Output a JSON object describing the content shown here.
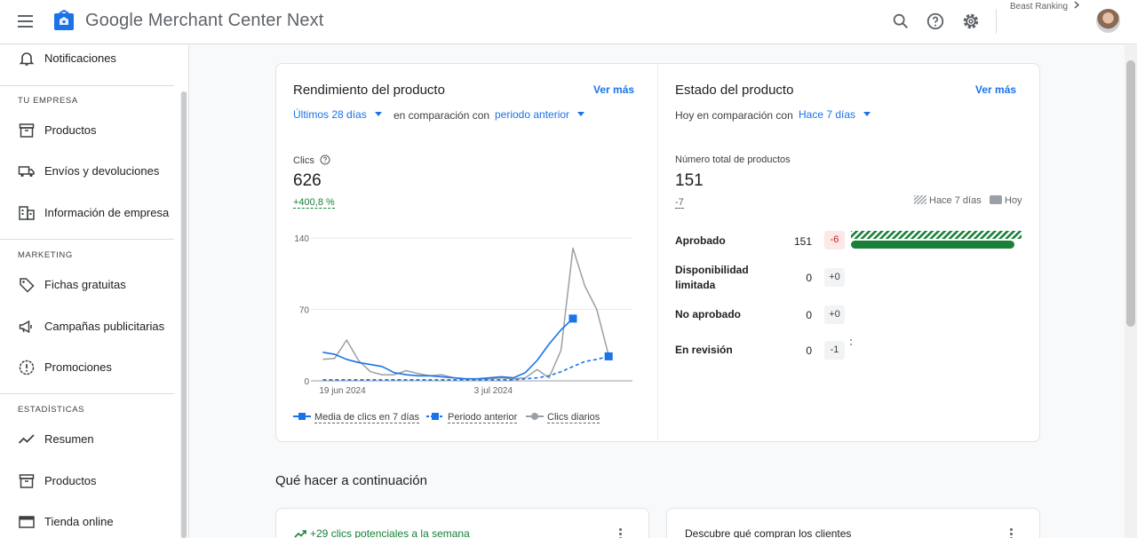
{
  "header": {
    "app_title": "Google Merchant Center Next",
    "account_name": "Beast Ranking"
  },
  "icons": [
    "menu-icon",
    "merchant-logo-icon",
    "search-icon",
    "help-icon",
    "settings-icon",
    "chevron-right-icon"
  ],
  "sidebar": {
    "notifications": "Notificaciones",
    "sections": [
      {
        "title": "TU EMPRESA",
        "items": [
          "Productos",
          "Envíos y devoluciones",
          "Información de empresa"
        ]
      },
      {
        "title": "MARKETING",
        "items": [
          "Fichas gratuitas",
          "Campañas publicitarias",
          "Promociones"
        ]
      },
      {
        "title": "ESTADÍSTICAS",
        "items": [
          "Resumen",
          "Productos",
          "Tienda online"
        ]
      }
    ]
  },
  "performance": {
    "title": "Rendimiento del producto",
    "see_more": "Ver más",
    "range": "Últimos 28 días",
    "compare_text": "en comparación con",
    "compare_period": "periodo anterior",
    "metric_label": "Clics",
    "metric_value": "626",
    "metric_delta": "+400,8 %"
  },
  "status": {
    "title": "Estado del producto",
    "see_more": "Ver más",
    "compare_text": "Hoy en comparación con",
    "compare_period": "Hace 7 días",
    "total_label": "Número total de productos",
    "total_value": "151",
    "total_delta": "-7",
    "legend_past": "Hace 7 días",
    "legend_today": "Hoy",
    "rows": [
      {
        "label": "Aprobado",
        "value": "151",
        "delta": "-6",
        "bar_fraction": 1.0
      },
      {
        "label": "Disponibilidad limitada",
        "value": "0",
        "delta": "+0",
        "bar_fraction": 0
      },
      {
        "label": "No aprobado",
        "value": "0",
        "delta": "+0",
        "bar_fraction": 0
      },
      {
        "label": "En revisión",
        "value": "0",
        "delta": "-1",
        "bar_fraction": 0
      }
    ],
    "colors": {
      "approved": "#188038",
      "negative": "#c5221f"
    }
  },
  "chart_data": {
    "type": "line",
    "ylim": [
      0,
      140
    ],
    "y_ticks": [
      "0",
      "70",
      "140"
    ],
    "x_tick_labels": [
      "19 jun 2024",
      "3 jul 2024"
    ],
    "x": [
      1,
      2,
      3,
      4,
      5,
      6,
      7,
      8,
      9,
      10,
      11,
      12,
      13,
      14,
      15,
      16,
      17,
      18,
      19,
      20,
      21,
      22,
      23,
      24,
      25,
      26,
      27,
      28
    ],
    "series": [
      {
        "name": "Media de clics en 7 días",
        "color": "#1a73e8",
        "style": "solid",
        "marker": "square",
        "values": [
          null,
          null,
          null,
          null,
          null,
          null,
          null,
          null,
          null,
          null,
          null,
          null,
          null,
          null,
          null,
          null,
          null,
          null,
          null,
          null,
          null,
          null,
          null,
          null,
          null,
          null,
          null,
          null
        ],
        "points": [
          [
            2,
            28
          ],
          [
            3,
            26
          ],
          [
            4,
            21
          ],
          [
            5,
            18
          ],
          [
            6,
            16
          ],
          [
            7,
            14
          ],
          [
            8,
            8
          ],
          [
            9,
            6
          ],
          [
            10,
            5
          ],
          [
            11,
            5
          ],
          [
            12,
            4
          ],
          [
            13,
            3
          ],
          [
            14,
            2
          ],
          [
            15,
            2
          ],
          [
            16,
            3
          ],
          [
            17,
            4
          ],
          [
            18,
            3
          ],
          [
            19,
            8
          ],
          [
            20,
            20
          ],
          [
            21,
            36
          ],
          [
            22,
            50
          ],
          [
            23,
            61
          ]
        ]
      },
      {
        "name": "Periodo anterior",
        "color": "#1a73e8",
        "style": "dashed",
        "marker": "square",
        "points": [
          [
            2,
            1
          ],
          [
            3,
            1
          ],
          [
            4,
            1
          ],
          [
            5,
            1
          ],
          [
            6,
            1
          ],
          [
            7,
            1
          ],
          [
            8,
            1
          ],
          [
            9,
            1
          ],
          [
            10,
            1
          ],
          [
            11,
            1
          ],
          [
            12,
            1
          ],
          [
            13,
            1
          ],
          [
            14,
            1
          ],
          [
            15,
            1
          ],
          [
            16,
            1
          ],
          [
            17,
            1
          ],
          [
            18,
            1
          ],
          [
            19,
            2
          ],
          [
            20,
            3
          ],
          [
            21,
            5
          ],
          [
            22,
            9
          ],
          [
            23,
            14
          ],
          [
            24,
            19
          ],
          [
            25,
            21
          ],
          [
            26,
            24
          ]
        ]
      },
      {
        "name": "Clics diarios",
        "color": "#9aa0a6",
        "style": "solid",
        "marker": "circle",
        "points": [
          [
            2,
            21
          ],
          [
            3,
            22
          ],
          [
            4,
            40
          ],
          [
            5,
            20
          ],
          [
            6,
            9
          ],
          [
            7,
            6
          ],
          [
            8,
            6
          ],
          [
            9,
            10
          ],
          [
            10,
            7
          ],
          [
            11,
            5
          ],
          [
            12,
            6
          ],
          [
            13,
            3
          ],
          [
            14,
            2
          ],
          [
            15,
            2
          ],
          [
            16,
            2
          ],
          [
            17,
            3
          ],
          [
            18,
            2
          ],
          [
            19,
            3
          ],
          [
            20,
            11
          ],
          [
            21,
            3
          ],
          [
            22,
            30
          ],
          [
            23,
            130
          ],
          [
            24,
            93
          ],
          [
            25,
            70
          ],
          [
            26,
            25
          ]
        ]
      }
    ]
  }
}
